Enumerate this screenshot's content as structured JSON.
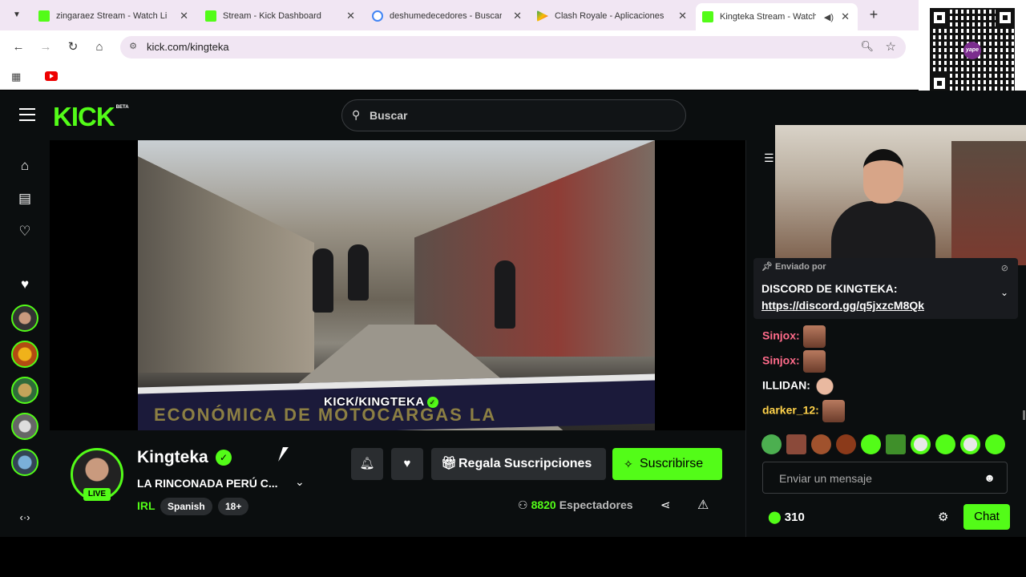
{
  "browser": {
    "tabs": [
      {
        "label": "zingaraez Stream - Watch Li",
        "favicon_color": "#53fc18"
      },
      {
        "label": "Stream - Kick Dashboard",
        "favicon_color": "#53fc18"
      },
      {
        "label": "deshumedecedores - Buscar",
        "favicon_color": "#4285f4"
      },
      {
        "label": "Clash Royale - Aplicaciones",
        "favicon_color": "#ea4335"
      },
      {
        "label": "Kingteka Stream - Watch",
        "favicon_color": "#53fc18",
        "active": true
      }
    ],
    "url": "kick.com/kingteka"
  },
  "qr_overlay": {
    "logo_text": "yape"
  },
  "kick": {
    "logo": "KICK",
    "logo_badge": "BETA",
    "search_placeholder": "Buscar",
    "accent_color": "#53fc18"
  },
  "stream": {
    "watermark": "KICK/KINGTEKA",
    "banner_text": "ECONÓMICA DE MOTOCARGAS LA",
    "channel_name": "Kingteka",
    "live_label": "LIVE",
    "title": "LA RINCONADA PERÚ C...",
    "category": "IRL",
    "tags": [
      "Spanish",
      "18+"
    ],
    "gift_label": "Regala Suscripciones",
    "subscribe_label": "Suscribirse",
    "viewer_count": "8820",
    "viewer_label": "Espectadores"
  },
  "chat": {
    "pinned_by": "Enviado por",
    "pinned_title": "DISCORD DE KINGTEKA:",
    "pinned_link": "https://discord.gg/q5jxzcM8Qk",
    "messages": [
      {
        "user": "Sinjox:",
        "color": "#ff6b8a"
      },
      {
        "user": "Sinjox:",
        "color": "#ff6b8a"
      },
      {
        "user": "ILLIDAN:",
        "color": "#ffffff"
      },
      {
        "user": "darker_12:",
        "color": "#ffd24a"
      }
    ],
    "input_placeholder": "Enviar un mensaje",
    "points": "310",
    "chat_button": "Chat"
  }
}
